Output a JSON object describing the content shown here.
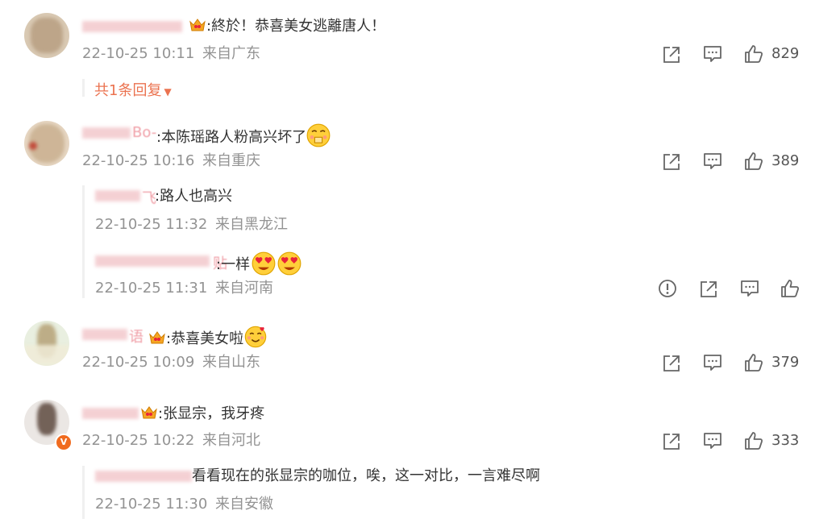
{
  "comments": [
    {
      "text": ":終於！恭喜美女逃離唐人！",
      "time": "22-10-25 10:11",
      "location": "来自广东",
      "likes": "829",
      "more_replies": "共1条回复"
    },
    {
      "name_tail": "Bo-",
      "text": ":本陈瑶路人粉高兴坏了",
      "time": "22-10-25 10:16",
      "location": "来自重庆",
      "likes": "389",
      "replies": [
        {
          "name_tail": "飞",
          "text": ":路人也高兴",
          "time": "22-10-25 11:32",
          "location": "来自黑龙江"
        },
        {
          "name_tail": "贴",
          "text": ":一样",
          "time": "22-10-25 11:31",
          "location": "来自河南"
        }
      ]
    },
    {
      "name_tail": "语",
      "text": ":恭喜美女啦",
      "time": "22-10-25 10:09",
      "location": "来自山东",
      "likes": "379"
    },
    {
      "text": ":张显宗，我牙疼",
      "time": "22-10-25 10:22",
      "location": "来自河北",
      "likes": "333",
      "replies": [
        {
          "text": "看看现在的张显宗的咖位，唉，这一对比，一言难尽啊",
          "time": "22-10-25 11:30",
          "location": "来自安徽"
        }
      ]
    }
  ],
  "icons": {
    "share": "share-icon",
    "comment": "comment-icon",
    "like": "thumbs-up-icon",
    "report": "report-icon"
  },
  "colors": {
    "accent": "#eb7350",
    "meta": "#939393"
  }
}
